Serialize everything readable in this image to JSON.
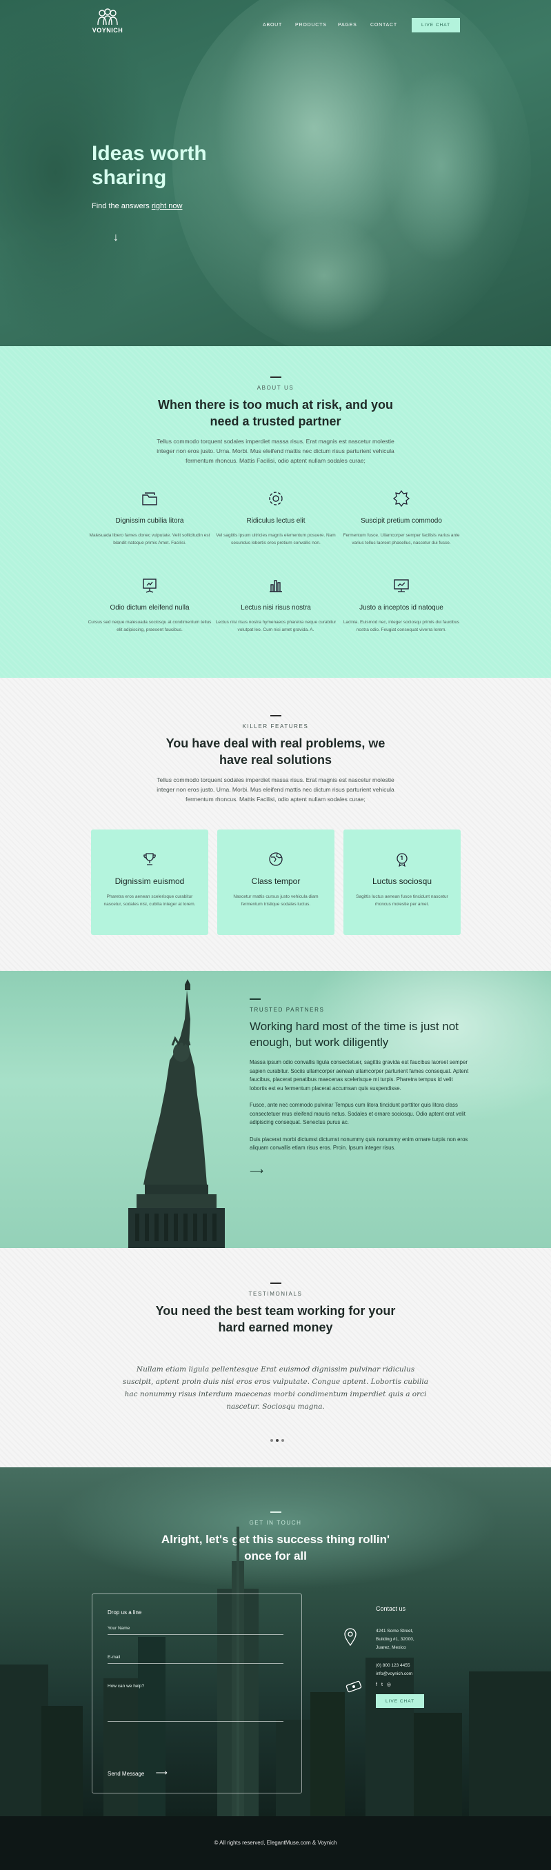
{
  "brand": {
    "name": "VOYNICH"
  },
  "nav": {
    "items": [
      "ABOUT",
      "PRODUCTS",
      "PAGES",
      "CONTACT"
    ],
    "chat": "LIVE CHAT"
  },
  "hero": {
    "title": "Ideas worth sharing",
    "sub_prefix": "Find the answers ",
    "sub_link": "right now"
  },
  "about": {
    "kicker": "ABOUT US",
    "title": "When there is too much at risk, and you need a trusted partner",
    "lead": "Tellus commodo torquent sodales imperdiet massa risus. Erat magnis est nascetur molestie integer non eros justo. Urna. Morbi. Mus eleifend mattis nec dictum risus parturient vehicula fermentum rhoncus. Mattis Facilisi, odio aptent nullam sodales curae;",
    "features": [
      {
        "icon": "folder-icon",
        "title": "Dignissim cubilia litora",
        "desc": "Malesuada libero fames donec vulputate. Velit sollicitudin est blandit natoque primis Amet. Facilisi."
      },
      {
        "icon": "gear-icon",
        "title": "Ridiculus lectus elit",
        "desc": "Vel sagittis ipsum ultricies magnis elementum posuere. Nam secundus lobortis eros pretium convallis non."
      },
      {
        "icon": "badge-icon",
        "title": "Suscipit pretium commodo",
        "desc": "Fermentum fusce. Ullamcorper semper facilisis varius ante varius tellus laoreet phasellus, nascetur dui fusce."
      },
      {
        "icon": "presentation-icon",
        "title": "Odio dictum eleifend nulla",
        "desc": "Cursus sed neque malesuada sociosqu at condimentum tellus elit adipiscing, praesent faucibus."
      },
      {
        "icon": "bar-chart-icon",
        "title": "Lectus nisi risus nostra",
        "desc": "Lectus nisi risus nostra hymenaeos pharetra neque curabitur volutpat leo. Cum nisi amet gravida. A."
      },
      {
        "icon": "monitor-icon",
        "title": "Justo a inceptos id natoque",
        "desc": "Lacinia. Euismod nec, integer sociosqu primis dui faucibus nostra odio. Feugiat consequat viverra lorem."
      }
    ]
  },
  "killer": {
    "kicker": "KILLER FEATURES",
    "title": "You have deal with real problems, we have real solutions",
    "lead": "Tellus commodo torquent sodales imperdiet massa risus. Erat magnis est nascetur molestie integer non eros justo. Urna. Morbi. Mus eleifend mattis nec dictum risus parturient vehicula fermentum rhoncus. Mattis Facilisi, odio aptent nullam sodales curae;",
    "cards": [
      {
        "icon": "trophy-icon",
        "title": "Dignissim euismod",
        "desc": "Pharetra eros aenean scelerisque curabitur nascetur, sodales nisi, cubilia integer at lorem."
      },
      {
        "icon": "globe-icon",
        "title": "Class tempor",
        "desc": "Nascetur mattis cursus justo vehicula diam fermentum tristique sodales luctus."
      },
      {
        "icon": "medal-icon",
        "title": "Luctus sociosqu",
        "desc": "Sagittis luctus aenean fusce tincidunt nascetur rhoncus molestie per amet."
      }
    ]
  },
  "partners": {
    "kicker": "TRUSTED PARTNERS",
    "title": "Working hard most of the time is just not enough, but work diligently",
    "paras": [
      "Massa ipsum odio convallis ligula consectetuer, sagittis gravida est faucibus laoreet semper sapien curabitur. Sociis ullamcorper aenean ullamcorper parturient fames consequat. Aptent faucibus, placerat penatibus maecenas scelerisque mi turpis. Pharetra tempus id velit lobortis est eu fermentum placerat accumsan quis suspendisse.",
      "Fusce, ante nec commodo pulvinar Tempus cum litora tincidunt porttitor quis litora class consectetuer mus eleifend mauris netus. Sodales et ornare sociosqu. Odio aptent erat velit adipiscing consequat. Senectus purus ac.",
      "Duis placerat morbi dictumst dictumst nonummy quis nonummy enim ornare turpis non eros aliquam convallis etiam risus eros. Proin. Ipsum integer risus."
    ]
  },
  "testimonials": {
    "kicker": "TESTIMONIALS",
    "title": "You need the best team working for your hard earned money",
    "quote": "Nullam etiam ligula pellentesque Erat euismod dignissim pulvinar ridiculus suscipit, aptent proin duis nisi eros eros vulputate. Congue aptent. Lobortis cubilia hac nonummy risus interdum maecenas morbi condimentum imperdiet quis a orci nascetur. Sociosqu magna."
  },
  "contact": {
    "kicker": "GET IN TOUCH",
    "title": "Alright, let's get this success thing rollin' once for all",
    "form_title": "Drop us a line",
    "name_ph": "Your Name",
    "email_ph": "E-mail",
    "msg_ph": "How can we help?",
    "send": "Send Message",
    "info_title": "Contact us",
    "address": [
      "4241 Some Street,",
      "Building #1, 32000,",
      "Juarez, Mexico"
    ],
    "phone": "(0) 800 123 4455",
    "email": "info@voynich.com",
    "chat": "LIVE CHAT"
  },
  "footer": {
    "text": "© All rights reserved, ElegantMuse.com & Voynich"
  }
}
